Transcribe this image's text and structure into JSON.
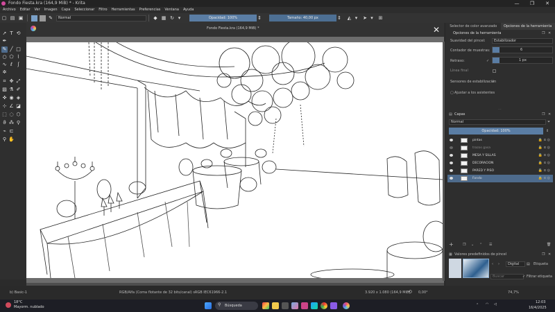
{
  "window": {
    "title": "Fondo Fiesta.kra (164,9 MiB) * - Krita",
    "controls": [
      "—",
      "❐",
      "✕"
    ]
  },
  "menu": [
    "Archivo",
    "Editar",
    "Ver",
    "Imagen",
    "Capa",
    "Seleccionar",
    "Filtro",
    "Herramientas",
    "Preferencias",
    "Ventana",
    "Ayuda"
  ],
  "toolbar": {
    "blend_mode": "Normal",
    "opacity": "Opacidad: 100%",
    "size": "Tamaño: 40,00 px"
  },
  "document": {
    "tab_title": "Fondo Fiesta.kra (164,9 MiB) *"
  },
  "dock": {
    "tabs": [
      "Selector de color avanzado",
      "Opciones de la herramienta"
    ],
    "tool_options_title": "Opciones de la herramienta",
    "smoothing_label": "Suavidad del pincel:",
    "smoothing_value": "Estabilizador",
    "sample_count_label": "Contador de muestras:",
    "sample_count_value": "6",
    "delay_label": "Retraso:",
    "delay_value": "1 px",
    "final_line_label": "Línea final",
    "stabilizer_sensors_label": "Sensores de estabilización",
    "snap_label": "Ajustar a los asistentes",
    "layers_title": "Capas",
    "layers_blend": "Normal",
    "layers_opacity": "Opacidad: 100%",
    "layers": [
      {
        "name": "pintas"
      },
      {
        "name": "trazos gasa"
      },
      {
        "name": "MESA Y SILLAS"
      },
      {
        "name": "DECORACION"
      },
      {
        "name": "PARED Y PISO"
      },
      {
        "name": "Fondo"
      }
    ],
    "brush_presets_title": "Valores predefinidos de pincel",
    "brush_filter": "Digital",
    "brush_tag": "Etiqueta",
    "search_placeholder": "Buscar",
    "filter_tag_label": "Filtrar etiqueta"
  },
  "status": {
    "brush": "b) Basic-1",
    "color_info": "RGB/Alfa (Coma flotante de 32 bits/canal)  sRGB IEC61966-2.1",
    "dimensions": "3.920 x 1.080 (164,9 MiB)",
    "rotation": "0,00°",
    "zoom": "74,7%"
  },
  "taskbar": {
    "weather_temp": "18°C",
    "weather_desc": "Mayorm. nublado",
    "search": "Búsqueda",
    "time": "12:03",
    "date": "16/4/2025"
  },
  "colors": {
    "accent": "#4e6b8c",
    "slider": "#5a7da4"
  }
}
